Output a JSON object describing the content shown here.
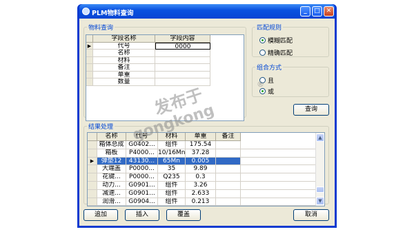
{
  "window": {
    "title": "PLM物料查询",
    "min": "_",
    "max": "□",
    "close": "✕"
  },
  "query_group": {
    "legend": "物料查询",
    "headers": [
      "字段名称",
      "字段内容"
    ],
    "rows": [
      {
        "name": "代号",
        "value": "0000"
      },
      {
        "name": "名称",
        "value": ""
      },
      {
        "name": "材料",
        "value": ""
      },
      {
        "name": "备注",
        "value": ""
      },
      {
        "name": "单重",
        "value": ""
      },
      {
        "name": "数量",
        "value": ""
      }
    ],
    "current_marker": "▶"
  },
  "match_rule": {
    "legend": "匹配规则",
    "options": [
      "模糊匹配",
      "精确匹配"
    ],
    "selected": 0
  },
  "combine": {
    "legend": "组合方式",
    "options": [
      "且",
      "或"
    ],
    "selected": 1
  },
  "query_button": "查询",
  "results": {
    "legend": "结果处理",
    "headers": [
      "名称",
      "代号",
      "材料",
      "单重",
      "备注"
    ],
    "rows": [
      [
        "箱体总成",
        "G0402...",
        "组件",
        "175.54",
        ""
      ],
      [
        "箱板",
        "P4000...",
        "10/16Mn",
        "37.28",
        ""
      ],
      [
        "弹垫12",
        "43130...",
        "65Mn",
        "0.005",
        ""
      ],
      [
        "大端盖",
        "P0000...",
        "35",
        "9.89",
        ""
      ],
      [
        "花键...",
        "P0000...",
        "Q235",
        "0.3",
        ""
      ],
      [
        "动力...",
        "G0901...",
        "组件",
        "3.26",
        ""
      ],
      [
        "减速...",
        "G0901...",
        "组件",
        "2.633",
        ""
      ],
      [
        "润滑...",
        "G0904...",
        "组件",
        "0.213",
        ""
      ]
    ],
    "selected_row": 2,
    "current_marker": "▶"
  },
  "buttons": {
    "add": "追加",
    "insert": "插入",
    "overwrite": "覆盖",
    "cancel": "取消"
  },
  "watermark": {
    "line1": "发布于",
    "line2": "gongkong",
    "reg": "®"
  }
}
